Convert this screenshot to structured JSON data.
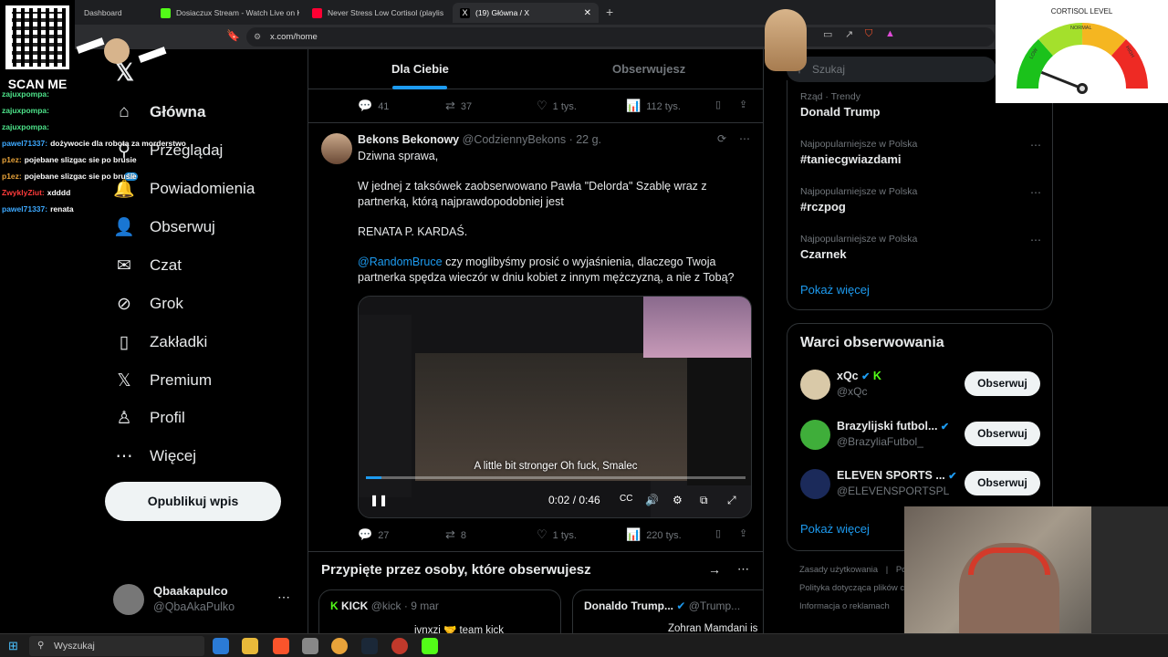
{
  "browser": {
    "tabs": [
      {
        "label": "Dashboard",
        "color": "#53fc18"
      },
      {
        "label": "Dosiaczux Stream - Watch Live on Ki",
        "color": "#53fc18"
      },
      {
        "label": "Never Stress Low Cortisol (playlis",
        "color": "#ff0033"
      },
      {
        "label": "(19) Główna / X",
        "color": "#ffffff"
      }
    ],
    "url": "x.com/home"
  },
  "nav": {
    "items": [
      {
        "label": "Główna",
        "icon": "home-icon",
        "glyph": "⌂"
      },
      {
        "label": "Przeglądaj",
        "icon": "explore-icon",
        "glyph": "⚲"
      },
      {
        "label": "Powiadomienia",
        "icon": "bell-icon",
        "glyph": "🔔"
      },
      {
        "label": "Obserwuj",
        "icon": "follow-icon",
        "glyph": "👤"
      },
      {
        "label": "Czat",
        "icon": "mail-icon",
        "glyph": "✉"
      },
      {
        "label": "Grok",
        "icon": "grok-icon",
        "glyph": "⊘"
      },
      {
        "label": "Zakładki",
        "icon": "bookmark-icon",
        "glyph": "▯"
      },
      {
        "label": "Premium",
        "icon": "x-premium-icon",
        "glyph": "𝕏"
      },
      {
        "label": "Profil",
        "icon": "profile-icon",
        "glyph": "♙"
      },
      {
        "label": "Więcej",
        "icon": "more-icon",
        "glyph": "⋯"
      }
    ],
    "notification_count": "19",
    "post_button": "Opublikuj wpis",
    "me": {
      "name": "Qbaakapulco",
      "handle": "@QbaAkaPulko"
    }
  },
  "timeline": {
    "tabs": {
      "for_you": "Dla Ciebie",
      "following": "Obserwujesz"
    },
    "prev_actions": {
      "replies": "41",
      "reposts": "37",
      "likes": "1 tys.",
      "views": "112 tys."
    },
    "tweet": {
      "name": "Bekons Bekonowy",
      "handle": "@CodziennyBekons",
      "time": "22 g.",
      "line1": "Dziwna sprawa,",
      "para2": "W jednej z taksówek zaobserwowano Pawła \"Delorda\" Szablę wraz z partnerką, którą najprawdopodobniej jest",
      "para3": "RENATA P. KARDAŚ.",
      "mention": "@RandomBruce",
      "para4": " czy moglibyśmy prosić o wyjaśnienia, dlaczego Twoja partnerka spędza wieczór w dniu kobiet z innym mężczyzną, a nie z Tobą?",
      "video": {
        "subtitle": "A little bit stronger Oh fuck, Smalec",
        "time": "0:02 / 0:46",
        "progress": 0.04
      },
      "actions": {
        "replies": "27",
        "reposts": "8",
        "likes": "1 tys.",
        "views": "220 tys."
      }
    },
    "pinned": {
      "title": "Przypięte przez osoby, które obserwujesz",
      "cards": [
        {
          "name": "KICK",
          "handle": "@kick · 9 mar",
          "text": "ivnxzi 🤝 team kick"
        },
        {
          "name": "Donaldo Trump...",
          "handle": "@Trump...",
          "text": "Zohran Mamdani is"
        }
      ]
    }
  },
  "right": {
    "search_placeholder": "Szukaj",
    "trends": [
      {
        "context": "Rząd · Trendy",
        "title": "Donald Trump"
      },
      {
        "context": "Najpopularniejsze w Polska",
        "title": "#taniecgwiazdami"
      },
      {
        "context": "Najpopularniejsze w Polska",
        "title": "#rczpog"
      },
      {
        "context": "Najpopularniejsze w Polska",
        "title": "Czarnek"
      }
    ],
    "show_more": "Pokaż więcej",
    "who_to_follow": {
      "title": "Warci obserwowania",
      "accounts": [
        {
          "name": "xQc",
          "handle": "@xQc",
          "color": "#d9c9a8"
        },
        {
          "name": "Brazylijski futbol...",
          "handle": "@BrazyliaFutbol_",
          "color": "#3fae3a"
        },
        {
          "name": "ELEVEN SPORTS ...",
          "handle": "@ELEVENSPORTSPL",
          "color": "#1b2a5a"
        }
      ],
      "follow_label": "Obserwuj",
      "show_more": "Pokaż więcej"
    },
    "footer": [
      "Zasady użytkowania",
      "Po",
      "Polityka dotycząca plików c",
      "Informacja o reklamach"
    ]
  },
  "overlay": {
    "qr_label": "SCAN ME",
    "chat": [
      {
        "user": "zajuxpompa:",
        "msg": "",
        "color": "#4de38a"
      },
      {
        "user": "zajuxpompa:",
        "msg": "",
        "color": "#4de38a"
      },
      {
        "user": "zajuxpompa:",
        "msg": "",
        "color": "#4de38a"
      },
      {
        "user": "pawel71337:",
        "msg": "dożywocie dla robota za morderstwo",
        "color": "#3da9ff"
      },
      {
        "user": "p1ez:",
        "msg": "pojebane slizgac sie po brusie",
        "color": "#e8a33a"
      },
      {
        "user": "p1ez:",
        "msg": "pojebane slizgac sie po brusie",
        "color": "#e8a33a"
      },
      {
        "user": "ZwyklyZiut:",
        "msg": "xdddd",
        "color": "#ff3b3b"
      },
      {
        "user": "pawel71337:",
        "msg": "renata",
        "color": "#3da9ff"
      }
    ],
    "cortisol": {
      "title": "CORTISOL LEVEL",
      "low": "LOW",
      "normal": "NORMAL",
      "high": "HIGH",
      "level": 0.12
    }
  },
  "taskbar": {
    "search": "Wyszukaj"
  }
}
